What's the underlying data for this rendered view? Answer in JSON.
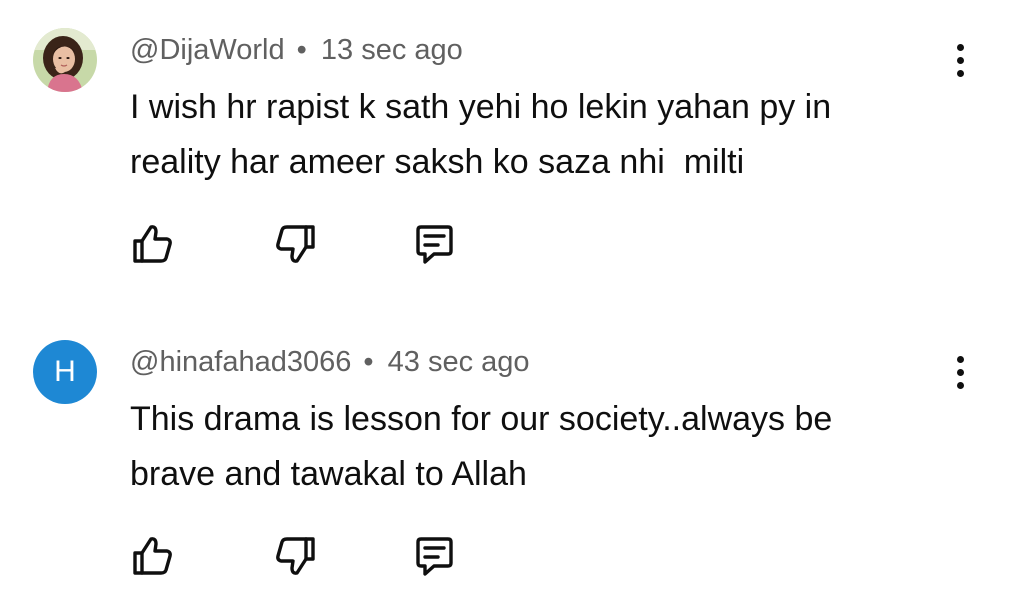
{
  "comments": [
    {
      "handle": "@DijaWorld",
      "separator": "•",
      "time": "13 sec ago",
      "avatar": {
        "type": "photo",
        "bg": "#c7d9a8"
      },
      "lines": [
        "I wish hr rapist k sath yehi ho lekin yahan py in",
        "reality har ameer saksh ko saza nhi  milti"
      ],
      "actions": [
        "thumbs-up-icon",
        "thumbs-down-icon",
        "reply-comment-icon"
      ],
      "menu_icon": "more-vertical-icon"
    },
    {
      "handle": "@hinafahad3066",
      "separator": "•",
      "time": "43 sec ago",
      "avatar": {
        "type": "letter",
        "letter": "H",
        "bg": "#1e88d4"
      },
      "lines": [
        "This drama is lesson for our society..always be",
        "brave and tawakal to Allah"
      ],
      "actions": [
        "thumbs-up-icon",
        "thumbs-down-icon",
        "reply-comment-icon"
      ],
      "menu_icon": "more-vertical-icon"
    }
  ],
  "colors": {
    "text_primary": "#0f0f0f",
    "text_secondary": "#606060",
    "background": "#ffffff"
  }
}
